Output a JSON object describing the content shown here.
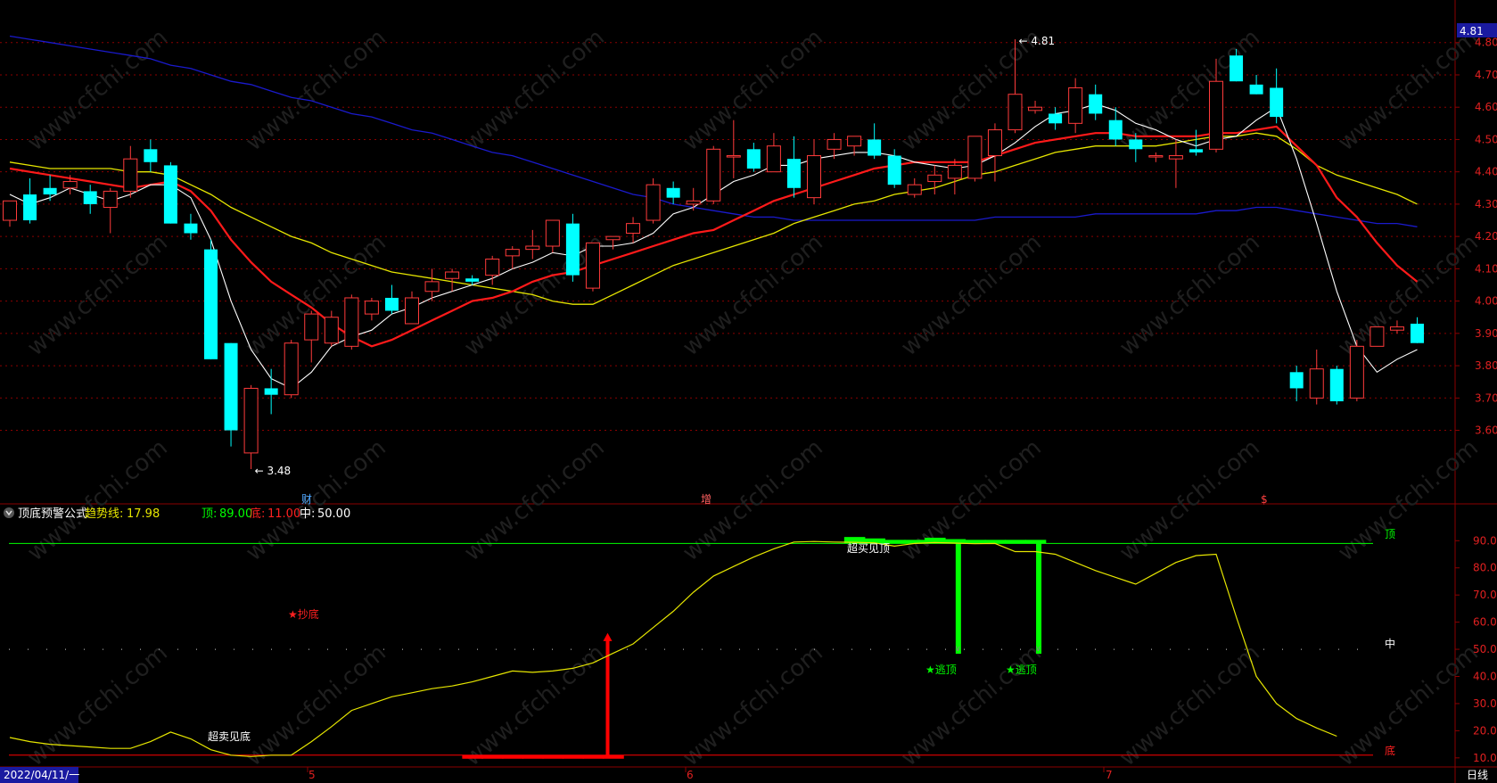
{
  "colors": {
    "up": "#ff3b3b",
    "down": "#00ffff",
    "ma5": "#ffffff",
    "ma10": "#ff1a1a",
    "ma20": "#e6e600",
    "ma60": "#1a1acc",
    "trend": "#e6e600",
    "top": "#00ff00",
    "bottom": "#ff0000",
    "grid": "#8b0000",
    "axis_text": "#e02020"
  },
  "price_panel": {
    "ylim": [
      3.4,
      4.86
    ],
    "yticks": [
      "4.80",
      "4.70",
      "4.60",
      "4.50",
      "4.40",
      "4.30",
      "4.20",
      "4.10",
      "4.00",
      "3.90",
      "3.80",
      "3.70",
      "3.60"
    ],
    "current_price": "4.81",
    "high_marker": "4.81",
    "low_marker": "3.48",
    "events": [
      "财",
      "增",
      "$"
    ]
  },
  "indicator_panel": {
    "name": "顶底预警公式",
    "trend_label": "趋势线:",
    "trend_value": "17.98",
    "top_label": "顶:",
    "top_value": "89.00",
    "bottom_label": "底:",
    "bottom_value": "11.00",
    "mid_label": "中:",
    "mid_value": "50.00",
    "ylim": [
      6,
      97
    ],
    "yticks": [
      "90.00",
      "80.00",
      "70.00",
      "60.00",
      "50.00",
      "40.00",
      "30.00",
      "20.00",
      "10.00"
    ],
    "line_tags": {
      "top": "顶",
      "mid": "中",
      "bottom": "底"
    },
    "annotations": {
      "oversold": "超卖见底",
      "buy_signal": "★抄底",
      "overbought": "超买见顶",
      "sell_signal_1": "★逃顶",
      "sell_signal_2": "★逃顶"
    }
  },
  "x_axis": {
    "start_date": "2022/04/11/一",
    "months": [
      "5",
      "6",
      "7"
    ],
    "period": "日线"
  },
  "chart_data": {
    "type": "candlestick",
    "candles": [
      {
        "o": 4.25,
        "h": 4.31,
        "l": 4.23,
        "c": 4.31
      },
      {
        "o": 4.33,
        "h": 4.38,
        "l": 4.24,
        "c": 4.25
      },
      {
        "o": 4.35,
        "h": 4.39,
        "l": 4.31,
        "c": 4.33
      },
      {
        "o": 4.35,
        "h": 4.39,
        "l": 4.33,
        "c": 4.37
      },
      {
        "o": 4.34,
        "h": 4.36,
        "l": 4.27,
        "c": 4.3
      },
      {
        "o": 4.29,
        "h": 4.35,
        "l": 4.21,
        "c": 4.34
      },
      {
        "o": 4.34,
        "h": 4.48,
        "l": 4.32,
        "c": 4.44
      },
      {
        "o": 4.47,
        "h": 4.5,
        "l": 4.4,
        "c": 4.43
      },
      {
        "o": 4.42,
        "h": 4.43,
        "l": 4.24,
        "c": 4.24
      },
      {
        "o": 4.24,
        "h": 4.27,
        "l": 4.19,
        "c": 4.21
      },
      {
        "o": 4.16,
        "h": 4.19,
        "l": 3.82,
        "c": 3.82
      },
      {
        "o": 3.87,
        "h": 3.87,
        "l": 3.55,
        "c": 3.6
      },
      {
        "o": 3.53,
        "h": 3.74,
        "l": 3.48,
        "c": 3.73
      },
      {
        "o": 3.73,
        "h": 3.79,
        "l": 3.65,
        "c": 3.71
      },
      {
        "o": 3.71,
        "h": 3.88,
        "l": 3.7,
        "c": 3.87
      },
      {
        "o": 3.88,
        "h": 3.97,
        "l": 3.81,
        "c": 3.96
      },
      {
        "o": 3.87,
        "h": 3.97,
        "l": 3.86,
        "c": 3.95
      },
      {
        "o": 3.86,
        "h": 4.02,
        "l": 3.85,
        "c": 4.01
      },
      {
        "o": 3.96,
        "h": 4.01,
        "l": 3.94,
        "c": 4.0
      },
      {
        "o": 4.01,
        "h": 4.05,
        "l": 3.96,
        "c": 3.97
      },
      {
        "o": 3.93,
        "h": 4.03,
        "l": 3.93,
        "c": 4.01
      },
      {
        "o": 4.03,
        "h": 4.1,
        "l": 4.0,
        "c": 4.06
      },
      {
        "o": 4.07,
        "h": 4.1,
        "l": 4.03,
        "c": 4.09
      },
      {
        "o": 4.07,
        "h": 4.08,
        "l": 4.05,
        "c": 4.06
      },
      {
        "o": 4.08,
        "h": 4.14,
        "l": 4.05,
        "c": 4.13
      },
      {
        "o": 4.14,
        "h": 4.17,
        "l": 4.1,
        "c": 4.16
      },
      {
        "o": 4.16,
        "h": 4.22,
        "l": 4.13,
        "c": 4.17
      },
      {
        "o": 4.17,
        "h": 4.25,
        "l": 4.15,
        "c": 4.25
      },
      {
        "o": 4.24,
        "h": 4.27,
        "l": 4.06,
        "c": 4.08
      },
      {
        "o": 4.04,
        "h": 4.18,
        "l": 4.03,
        "c": 4.18
      },
      {
        "o": 4.19,
        "h": 4.2,
        "l": 4.16,
        "c": 4.2
      },
      {
        "o": 4.21,
        "h": 4.26,
        "l": 4.18,
        "c": 4.24
      },
      {
        "o": 4.25,
        "h": 4.38,
        "l": 4.24,
        "c": 4.36
      },
      {
        "o": 4.35,
        "h": 4.37,
        "l": 4.3,
        "c": 4.32
      },
      {
        "o": 4.3,
        "h": 4.35,
        "l": 4.28,
        "c": 4.31
      },
      {
        "o": 4.31,
        "h": 4.48,
        "l": 4.3,
        "c": 4.47
      },
      {
        "o": 4.45,
        "h": 4.56,
        "l": 4.38,
        "c": 4.45
      },
      {
        "o": 4.47,
        "h": 4.49,
        "l": 4.4,
        "c": 4.41
      },
      {
        "o": 4.4,
        "h": 4.52,
        "l": 4.4,
        "c": 4.48
      },
      {
        "o": 4.44,
        "h": 4.51,
        "l": 4.32,
        "c": 4.35
      },
      {
        "o": 4.32,
        "h": 4.5,
        "l": 4.3,
        "c": 4.45
      },
      {
        "o": 4.47,
        "h": 4.52,
        "l": 4.44,
        "c": 4.5
      },
      {
        "o": 4.48,
        "h": 4.51,
        "l": 4.45,
        "c": 4.51
      },
      {
        "o": 4.5,
        "h": 4.55,
        "l": 4.44,
        "c": 4.45
      },
      {
        "o": 4.45,
        "h": 4.47,
        "l": 4.35,
        "c": 4.36
      },
      {
        "o": 4.33,
        "h": 4.38,
        "l": 4.32,
        "c": 4.36
      },
      {
        "o": 4.37,
        "h": 4.42,
        "l": 4.33,
        "c": 4.39
      },
      {
        "o": 4.38,
        "h": 4.44,
        "l": 4.33,
        "c": 4.42
      },
      {
        "o": 4.38,
        "h": 4.49,
        "l": 4.37,
        "c": 4.51
      },
      {
        "o": 4.45,
        "h": 4.55,
        "l": 4.37,
        "c": 4.53
      },
      {
        "o": 4.53,
        "h": 4.81,
        "l": 4.52,
        "c": 4.64
      },
      {
        "o": 4.59,
        "h": 4.62,
        "l": 4.58,
        "c": 4.6
      },
      {
        "o": 4.58,
        "h": 4.6,
        "l": 4.53,
        "c": 4.55
      },
      {
        "o": 4.55,
        "h": 4.69,
        "l": 4.52,
        "c": 4.66
      },
      {
        "o": 4.64,
        "h": 4.67,
        "l": 4.56,
        "c": 4.58
      },
      {
        "o": 4.56,
        "h": 4.6,
        "l": 4.48,
        "c": 4.5
      },
      {
        "o": 4.5,
        "h": 4.52,
        "l": 4.43,
        "c": 4.47
      },
      {
        "o": 4.45,
        "h": 4.46,
        "l": 4.43,
        "c": 4.45
      },
      {
        "o": 4.44,
        "h": 4.5,
        "l": 4.35,
        "c": 4.45
      },
      {
        "o": 4.47,
        "h": 4.53,
        "l": 4.45,
        "c": 4.46
      },
      {
        "o": 4.47,
        "h": 4.75,
        "l": 4.46,
        "c": 4.68
      },
      {
        "o": 4.76,
        "h": 4.78,
        "l": 4.68,
        "c": 4.68
      },
      {
        "o": 4.67,
        "h": 4.7,
        "l": 4.64,
        "c": 4.64
      },
      {
        "o": 4.66,
        "h": 4.72,
        "l": 4.55,
        "c": 4.57
      },
      {
        "o": 3.78,
        "h": 3.8,
        "l": 3.69,
        "c": 3.73
      },
      {
        "o": 3.7,
        "h": 3.85,
        "l": 3.68,
        "c": 3.79
      },
      {
        "o": 3.79,
        "h": 3.8,
        "l": 3.68,
        "c": 3.69
      },
      {
        "o": 3.7,
        "h": 3.88,
        "l": 3.69,
        "c": 3.86
      },
      {
        "o": 3.86,
        "h": 3.92,
        "l": 3.86,
        "c": 3.92
      },
      {
        "o": 3.91,
        "h": 3.94,
        "l": 3.9,
        "c": 3.92
      },
      {
        "o": 3.93,
        "h": 3.95,
        "l": 3.87,
        "c": 3.87
      }
    ],
    "ma5": [
      4.33,
      4.3,
      4.32,
      4.35,
      4.33,
      4.31,
      4.33,
      4.36,
      4.36,
      4.32,
      4.19,
      4.0,
      3.85,
      3.76,
      3.73,
      3.78,
      3.86,
      3.89,
      3.91,
      3.96,
      3.98,
      4.01,
      4.03,
      4.05,
      4.07,
      4.1,
      4.12,
      4.15,
      4.14,
      4.17,
      4.17,
      4.18,
      4.21,
      4.27,
      4.29,
      4.33,
      4.37,
      4.39,
      4.42,
      4.42,
      4.44,
      4.45,
      4.46,
      4.46,
      4.45,
      4.43,
      4.42,
      4.41,
      4.42,
      4.45,
      4.49,
      4.54,
      4.58,
      4.59,
      4.61,
      4.59,
      4.55,
      4.53,
      4.5,
      4.48,
      4.5,
      4.51,
      4.56,
      4.6,
      4.44,
      4.24,
      4.03,
      3.86,
      3.78,
      3.82,
      3.85
    ],
    "ma10": [
      4.41,
      4.4,
      4.39,
      4.38,
      4.37,
      4.36,
      4.35,
      4.36,
      4.37,
      4.34,
      4.28,
      4.19,
      4.12,
      4.06,
      4.02,
      3.98,
      3.93,
      3.89,
      3.86,
      3.88,
      3.91,
      3.94,
      3.97,
      4.0,
      4.01,
      4.03,
      4.06,
      4.08,
      4.09,
      4.11,
      4.13,
      4.15,
      4.17,
      4.19,
      4.21,
      4.22,
      4.25,
      4.28,
      4.31,
      4.33,
      4.35,
      4.37,
      4.39,
      4.41,
      4.42,
      4.43,
      4.43,
      4.43,
      4.43,
      4.45,
      4.47,
      4.49,
      4.5,
      4.51,
      4.52,
      4.52,
      4.51,
      4.51,
      4.51,
      4.51,
      4.52,
      4.52,
      4.53,
      4.54,
      4.48,
      4.42,
      4.32,
      4.26,
      4.18,
      4.11,
      4.06
    ],
    "ma20": [
      4.43,
      4.42,
      4.41,
      4.41,
      4.41,
      4.41,
      4.4,
      4.4,
      4.39,
      4.36,
      4.33,
      4.29,
      4.26,
      4.23,
      4.2,
      4.18,
      4.15,
      4.13,
      4.11,
      4.09,
      4.08,
      4.07,
      4.06,
      4.05,
      4.04,
      4.03,
      4.02,
      4.0,
      3.99,
      3.99,
      4.02,
      4.05,
      4.08,
      4.11,
      4.13,
      4.15,
      4.17,
      4.19,
      4.21,
      4.24,
      4.26,
      4.28,
      4.3,
      4.31,
      4.33,
      4.34,
      4.35,
      4.37,
      4.39,
      4.4,
      4.42,
      4.44,
      4.46,
      4.47,
      4.48,
      4.48,
      4.48,
      4.48,
      4.49,
      4.5,
      4.51,
      4.51,
      4.52,
      4.51,
      4.47,
      4.42,
      4.39,
      4.37,
      4.35,
      4.33,
      4.3
    ],
    "ma60": [
      4.82,
      4.81,
      4.8,
      4.79,
      4.78,
      4.77,
      4.76,
      4.75,
      4.73,
      4.72,
      4.7,
      4.68,
      4.67,
      4.65,
      4.63,
      4.62,
      4.6,
      4.58,
      4.57,
      4.55,
      4.53,
      4.52,
      4.5,
      4.48,
      4.46,
      4.45,
      4.43,
      4.41,
      4.39,
      4.37,
      4.35,
      4.33,
      4.32,
      4.3,
      4.29,
      4.28,
      4.27,
      4.26,
      4.26,
      4.25,
      4.25,
      4.25,
      4.25,
      4.25,
      4.25,
      4.25,
      4.25,
      4.25,
      4.25,
      4.26,
      4.26,
      4.26,
      4.26,
      4.26,
      4.27,
      4.27,
      4.27,
      4.27,
      4.27,
      4.27,
      4.28,
      4.28,
      4.29,
      4.29,
      4.28,
      4.27,
      4.26,
      4.25,
      4.24,
      4.24,
      4.23
    ],
    "trend": [
      17.5,
      16,
      15,
      14.5,
      14,
      13.5,
      13.5,
      16,
      19.5,
      17,
      13,
      11,
      10.5,
      11,
      11,
      16,
      21.5,
      27.5,
      30,
      32.5,
      34,
      35.5,
      36.5,
      38,
      40,
      42,
      41.5,
      42,
      43,
      45,
      48.5,
      52,
      58,
      64,
      71,
      77,
      80.5,
      84,
      87,
      89.5,
      89.7,
      89.5,
      89.4,
      89.2,
      88,
      89,
      89.3,
      89.1,
      88.9,
      89,
      86,
      86,
      85,
      82,
      79,
      76.5,
      74,
      78,
      82,
      84.5,
      85,
      62,
      40,
      30,
      24.5,
      21,
      17.98
    ],
    "signals": {
      "bottom_hist": [
        23,
        24,
        25,
        26,
        27,
        28,
        29,
        30
      ],
      "buy_index": 30,
      "top_hist": [
        42,
        43,
        44,
        45,
        46,
        47
      ],
      "sell_bars": [
        47,
        51
      ],
      "top_hist2": [
        48,
        49,
        50,
        51
      ]
    }
  }
}
